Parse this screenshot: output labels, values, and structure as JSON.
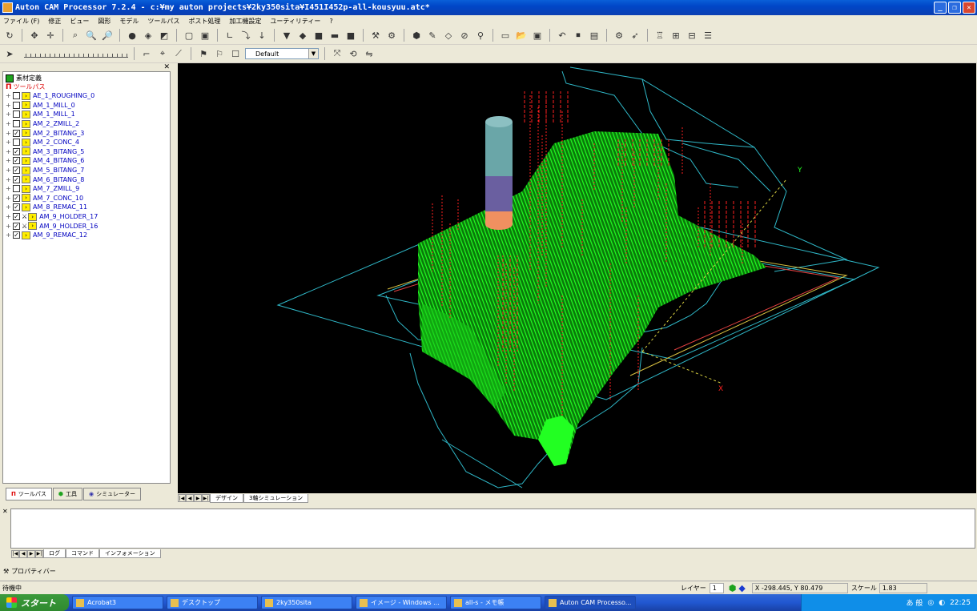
{
  "window": {
    "title": "Auton CAM Processor 7.2.4 - c:¥my auton projects¥2ky350sita¥I451I452p-all-kousyuu.atc*"
  },
  "menu": [
    "ファイル (F)",
    "修正",
    "ビュー",
    "図形",
    "モデル",
    "ツールパス",
    "ポスト処理",
    "加工機設定",
    "ユーティリティー",
    "?"
  ],
  "toolbar2": {
    "combo_value": "Default"
  },
  "tree": {
    "root_label": "素材定義",
    "toolpath_label": "ツールパス",
    "items": [
      {
        "label": "AE_1_ROUGHING_0",
        "checked": false,
        "type": "op"
      },
      {
        "label": "AM_1_MILL_0",
        "checked": false,
        "type": "op"
      },
      {
        "label": "AM_1_MILL_1",
        "checked": false,
        "type": "op"
      },
      {
        "label": "AM_2_ZMILL_2",
        "checked": false,
        "type": "op"
      },
      {
        "label": "AM_2_BITANG_3",
        "checked": true,
        "type": "op"
      },
      {
        "label": "AM_2_CONC_4",
        "checked": false,
        "type": "op"
      },
      {
        "label": "AM_3_BITANG_5",
        "checked": true,
        "type": "op"
      },
      {
        "label": "AM_4_BITANG_6",
        "checked": true,
        "type": "op"
      },
      {
        "label": "AM_5_BITANG_7",
        "checked": true,
        "type": "op"
      },
      {
        "label": "AM_6_BITANG_8",
        "checked": true,
        "type": "op"
      },
      {
        "label": "AM_7_ZMILL_9",
        "checked": false,
        "type": "op"
      },
      {
        "label": "AM_7_CONC_10",
        "checked": true,
        "type": "op"
      },
      {
        "label": "AM_8_REMAC_11",
        "checked": true,
        "type": "op"
      },
      {
        "label": "AM_9_HOLDER_17",
        "checked": true,
        "type": "holder"
      },
      {
        "label": "AM_9_HOLDER_16",
        "checked": true,
        "type": "holder"
      },
      {
        "label": "AM_9_REMAC_12",
        "checked": true,
        "type": "op"
      }
    ]
  },
  "panel_tabs": {
    "toolpath": "ツールパス",
    "tool": "工具",
    "simulator": "シミュレーター"
  },
  "view_tabs": {
    "design": "デザイン",
    "sim3d": "3軸シミュレーション"
  },
  "axis_labels": {
    "x": "X",
    "y": "Y"
  },
  "output_tabs": {
    "log": "ログ",
    "command": "コマンド",
    "info": "インフォメーション"
  },
  "property_bar": "プロパティバー",
  "status": {
    "text": "待機中",
    "layer_label": "レイヤー",
    "layer_value": "1",
    "coords": "X -298.445, Y 80.479",
    "scale_label": "スケール",
    "scale_value": "1.83"
  },
  "taskbar": {
    "start": "スタート",
    "tasks": [
      {
        "label": "Acrobat3",
        "active": false
      },
      {
        "label": "デスクトップ",
        "active": false
      },
      {
        "label": "2ky350sita",
        "active": false
      },
      {
        "label": "イメージ - Windows ...",
        "active": false
      },
      {
        "label": "all-s - メモ帳",
        "active": false
      },
      {
        "label": "Auton CAM Processo...",
        "active": true
      }
    ],
    "ime": "あ 般",
    "clock": "22:25"
  },
  "colors": {
    "toolpath_green": "#22ff22",
    "rapid_red": "#ff2020",
    "wire_cyan": "#2fb8c8",
    "tool_teal": "#6aa6a8",
    "tool_purple": "#6a5fa0",
    "tool_orange": "#f09060"
  }
}
